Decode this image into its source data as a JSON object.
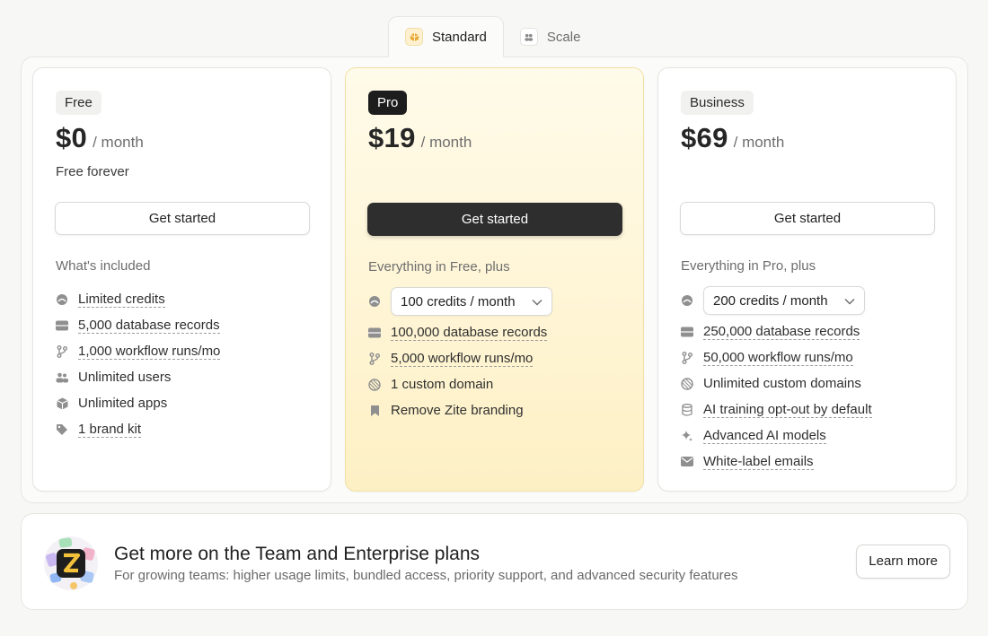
{
  "tabs": [
    {
      "label": "Standard",
      "icon": "box-icon",
      "active": true
    },
    {
      "label": "Scale",
      "icon": "users-icon",
      "active": false
    }
  ],
  "plans": {
    "free": {
      "badge": "Free",
      "price": "$0",
      "period": "/ month",
      "subtitle": "Free forever",
      "cta": "Get started",
      "section_title": "What's included",
      "features": [
        {
          "icon": "credits-icon",
          "text": "Limited credits"
        },
        {
          "icon": "database-icon",
          "text": "5,000 database records"
        },
        {
          "icon": "workflow-icon",
          "text": "1,000 workflow runs/mo"
        },
        {
          "icon": "users-icon",
          "text": "Unlimited users"
        },
        {
          "icon": "cube-icon",
          "text": "Unlimited apps"
        },
        {
          "icon": "brand-kit-icon",
          "text": "1 brand kit"
        }
      ]
    },
    "pro": {
      "badge": "Pro",
      "price": "$19",
      "period": "/ month",
      "cta": "Get started",
      "section_title": "Everything in Free, plus",
      "credits_select": "100 credits / month",
      "features": [
        {
          "icon": "database-icon",
          "text": "100,000 database records"
        },
        {
          "icon": "workflow-icon",
          "text": "5,000 workflow runs/mo"
        },
        {
          "icon": "globe-icon",
          "text": "1 custom domain"
        },
        {
          "icon": "bookmark-icon",
          "text": "Remove Zite branding"
        }
      ]
    },
    "business": {
      "badge": "Business",
      "price": "$69",
      "period": "/ month",
      "cta": "Get started",
      "section_title": "Everything in Pro, plus",
      "credits_select": "200 credits / month",
      "features": [
        {
          "icon": "database-icon",
          "text": "250,000 database records"
        },
        {
          "icon": "workflow-icon",
          "text": "50,000 workflow runs/mo"
        },
        {
          "icon": "globe-icon",
          "text": "Unlimited custom domains"
        },
        {
          "icon": "stack-icon",
          "text": "AI training opt-out by default"
        },
        {
          "icon": "sparkle-icon",
          "text": "Advanced AI models"
        },
        {
          "icon": "mail-icon",
          "text": "White-label emails"
        }
      ]
    }
  },
  "banner": {
    "title": "Get more on the Team and Enterprise plans",
    "subtitle": "For growing teams: higher usage limits, bundled access, priority support, and advanced security features",
    "cta": "Learn more"
  },
  "colors": {
    "pro_card_bg": "#fff6d8",
    "dark_button": "#2e2e2e",
    "page_bg": "#f7f7f6"
  }
}
